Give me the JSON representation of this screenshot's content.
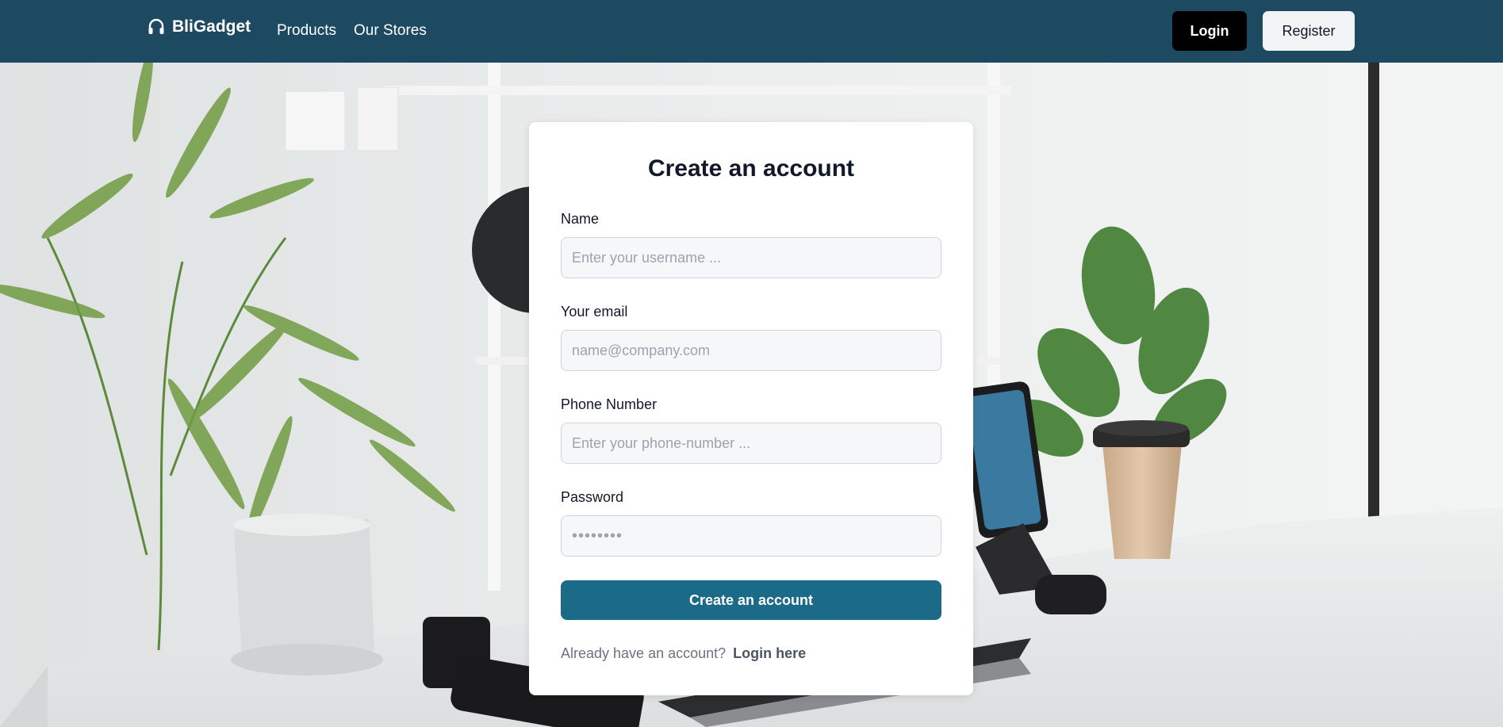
{
  "navbar": {
    "brand": "BliGadget",
    "brand_icon": "headphones-icon",
    "links": [
      "Products",
      "Our Stores"
    ],
    "login_label": "Login",
    "register_label": "Register",
    "background_color": "#1e4a61"
  },
  "form": {
    "title": "Create an account",
    "fields": [
      {
        "label": "Name",
        "placeholder": "Enter your username ..."
      },
      {
        "label": "Your email",
        "placeholder": "name@company.com"
      },
      {
        "label": "Phone Number",
        "placeholder": "Enter your phone-number ..."
      },
      {
        "label": "Password",
        "value": "••••••••"
      }
    ],
    "submit_label": "Create an account",
    "submit_color": "#1b6a88",
    "footer_text": "Already have an account?",
    "footer_link": "Login here"
  }
}
